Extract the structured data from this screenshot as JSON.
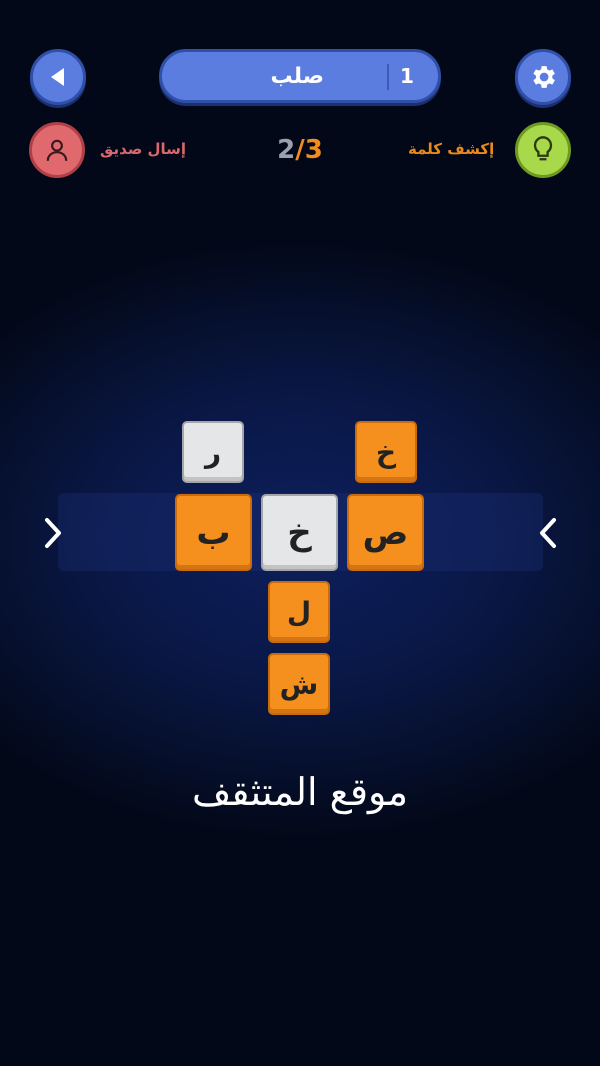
{
  "header": {
    "level_word": "صلب",
    "level_number": "1"
  },
  "actions": {
    "send_friend_label": "إسال صديق",
    "reveal_word_label": "إكشف كلمة"
  },
  "progress": {
    "found": "2",
    "separator": "/",
    "total": "3"
  },
  "board": {
    "tiles": [
      {
        "letter": "ر",
        "style": "white"
      },
      {
        "letter": "خ",
        "style": "orange"
      },
      {
        "letter": "ب",
        "style": "orange"
      },
      {
        "letter": "خ",
        "style": "white"
      },
      {
        "letter": "ص",
        "style": "orange"
      },
      {
        "letter": "ل",
        "style": "orange"
      },
      {
        "letter": "ش",
        "style": "orange"
      }
    ]
  },
  "footer": {
    "watermark": "موقع المتثقف"
  },
  "icons": {
    "back": "back-triangle-icon",
    "settings": "gear-icon",
    "friend": "person-icon",
    "hint": "lightbulb-icon",
    "prev": "chevron-left-icon",
    "next": "chevron-right-icon"
  },
  "colors": {
    "accent_blue": "#5b7de0",
    "orange_tile": "#f5901f",
    "white_tile": "#e5e6e8",
    "friend_red": "#e0696e",
    "hint_green": "#a8d94a"
  }
}
